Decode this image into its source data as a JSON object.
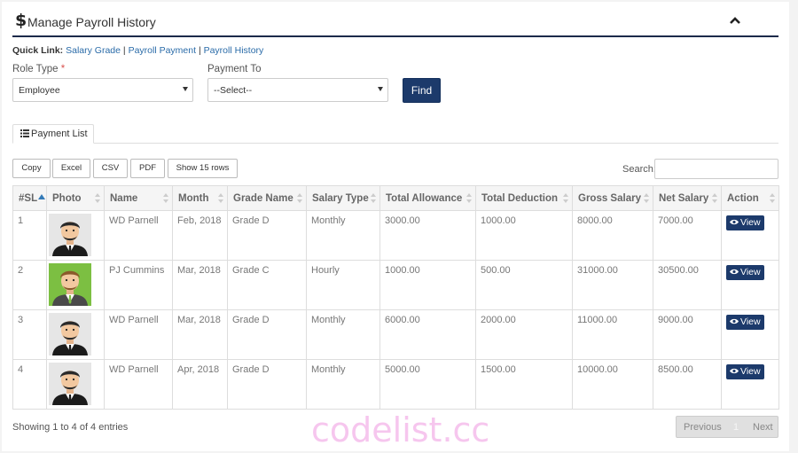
{
  "header": {
    "title": "Manage Payroll History"
  },
  "quick_link": {
    "label": "Quick Link:",
    "links": [
      "Salary Grade",
      "Payroll Payment",
      "Payroll History"
    ],
    "separator": "|"
  },
  "filters": {
    "role_type_label": "Role Type",
    "required_mark": "*",
    "role_type_value": "Employee",
    "payment_to_label": "Payment To",
    "payment_to_value": "--Select--",
    "find_label": "Find"
  },
  "tab": {
    "label": "Payment List"
  },
  "export_buttons": [
    "Copy",
    "Excel",
    "CSV",
    "PDF",
    "Show 15 rows"
  ],
  "search": {
    "label": "Search:",
    "value": ""
  },
  "table": {
    "columns": [
      "#SL",
      "Photo",
      "Name",
      "Month",
      "Grade Name",
      "Salary Type",
      "Total Allowance",
      "Total Deduction",
      "Gross Salary",
      "Net Salary",
      "Action"
    ],
    "rows": [
      {
        "sl": "1",
        "avatar": "man-suit-avatar",
        "name": "WD Parnell",
        "month": "Feb, 2018",
        "grade": "Grade D",
        "salary_type": "Monthly",
        "allowance": "3000.00",
        "deduction": "1000.00",
        "gross": "8000.00",
        "net": "7000.00",
        "action": "View"
      },
      {
        "sl": "2",
        "avatar": "man-green-avatar",
        "name": "PJ Cummins",
        "month": "Mar, 2018",
        "grade": "Grade C",
        "salary_type": "Hourly",
        "allowance": "1000.00",
        "deduction": "500.00",
        "gross": "31000.00",
        "net": "30500.00",
        "action": "View"
      },
      {
        "sl": "3",
        "avatar": "man-suit-avatar",
        "name": "WD Parnell",
        "month": "Mar, 2018",
        "grade": "Grade D",
        "salary_type": "Monthly",
        "allowance": "6000.00",
        "deduction": "2000.00",
        "gross": "11000.00",
        "net": "9000.00",
        "action": "View"
      },
      {
        "sl": "4",
        "avatar": "man-suit-avatar",
        "name": "WD Parnell",
        "month": "Apr, 2018",
        "grade": "Grade D",
        "salary_type": "Monthly",
        "allowance": "5000.00",
        "deduction": "1500.00",
        "gross": "10000.00",
        "net": "8500.00",
        "action": "View"
      }
    ]
  },
  "footer": {
    "info": "Showing 1 to 4 of 4 entries",
    "previous": "Previous",
    "page": "1",
    "next": "Next"
  },
  "watermark": "codelist.cc",
  "colors": {
    "primary": "#1c3a6b",
    "link": "#2a6ba8",
    "required": "#d9534f",
    "header_rule": "#1c2a4a"
  },
  "icons": {
    "header": "dollar-icon",
    "collapse": "chevron-up-icon",
    "tab": "list-icon",
    "view": "eye-icon"
  }
}
